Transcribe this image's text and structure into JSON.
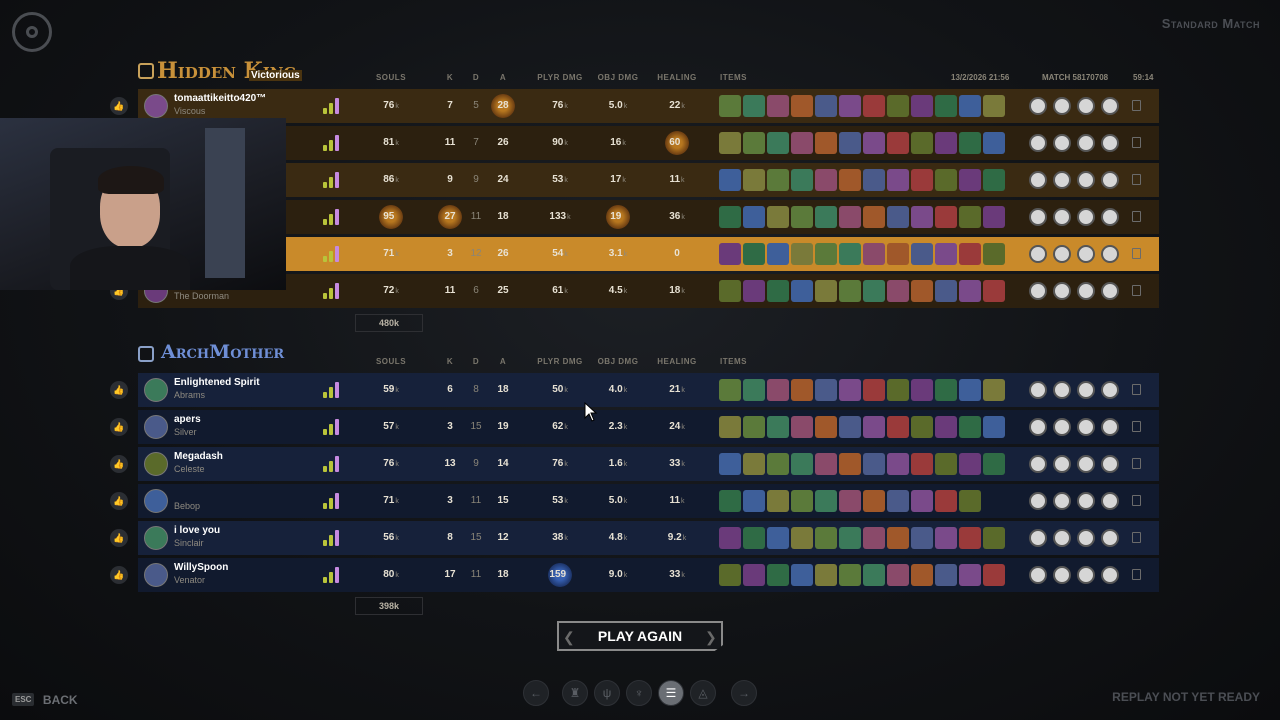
{
  "header": {
    "mode": "Standard Match",
    "date": "13/2/2026 21:56",
    "match_id": "Match 58170708",
    "duration": "59:14"
  },
  "columns": {
    "souls": "SOULS",
    "k": "K",
    "d": "D",
    "a": "A",
    "plyr_dmg": "PLYR DMG",
    "obj_dmg": "OBJ DMG",
    "healing": "HEALING",
    "items": "ITEMS"
  },
  "team1": {
    "name": "Hidden King",
    "result": "Victorious",
    "total_souls": "480k",
    "players": [
      {
        "name": "tomaattikeitto420™",
        "hero": "Viscous",
        "souls": "76",
        "k": "7",
        "d": "5",
        "a": "28",
        "plyr": "76",
        "obj": "5.0",
        "heal": "22"
      },
      {
        "name": "",
        "hero": "",
        "souls": "81",
        "k": "11",
        "d": "7",
        "a": "26",
        "plyr": "90",
        "obj": "16",
        "heal": "60"
      },
      {
        "name": "",
        "hero": "",
        "souls": "86",
        "k": "9",
        "d": "9",
        "a": "24",
        "plyr": "53",
        "obj": "17",
        "heal": "11"
      },
      {
        "name": "",
        "hero": "",
        "souls": "95",
        "k": "27",
        "d": "11",
        "a": "18",
        "plyr": "133",
        "obj": "19",
        "heal": "36"
      },
      {
        "name": "",
        "hero": "",
        "souls": "71",
        "k": "3",
        "d": "12",
        "a": "26",
        "plyr": "54",
        "obj": "3.1",
        "heal": "0"
      },
      {
        "name": "",
        "hero": "The Doorman",
        "souls": "72",
        "k": "11",
        "d": "6",
        "a": "25",
        "plyr": "61",
        "obj": "4.5",
        "heal": "18"
      }
    ]
  },
  "team2": {
    "name": "ArchMother",
    "total_souls": "398k",
    "players": [
      {
        "name": "Enlightened Spirit",
        "hero": "Abrams",
        "souls": "59",
        "k": "6",
        "d": "8",
        "a": "18",
        "plyr": "50",
        "obj": "4.0",
        "heal": "21"
      },
      {
        "name": "apers",
        "hero": "Silver",
        "souls": "57",
        "k": "3",
        "d": "15",
        "a": "19",
        "plyr": "62",
        "obj": "2.3",
        "heal": "24"
      },
      {
        "name": "Megadash",
        "hero": "Celeste",
        "souls": "76",
        "k": "13",
        "d": "9",
        "a": "14",
        "plyr": "76",
        "obj": "1.6",
        "heal": "33"
      },
      {
        "name": "",
        "hero": "Bebop",
        "souls": "71",
        "k": "3",
        "d": "11",
        "a": "15",
        "plyr": "53",
        "obj": "5.0",
        "heal": "11"
      },
      {
        "name": "i love you",
        "hero": "Sinclair",
        "souls": "56",
        "k": "8",
        "d": "15",
        "a": "12",
        "plyr": "38",
        "obj": "4.8",
        "heal": "9.2"
      },
      {
        "name": "WillySpoon",
        "hero": "Venator",
        "souls": "80",
        "k": "17",
        "d": "11",
        "a": "18",
        "plyr": "159",
        "obj": "9.0",
        "heal": "33"
      }
    ]
  },
  "unit_suffix": "k",
  "footer": {
    "esc_key": "ESC",
    "back_label": "BACK",
    "play_again_label": "PLAY AGAIN",
    "replay_status": "REPLAY NOT YET READY"
  },
  "colors": {
    "team1_row": "#3a2a12",
    "team1_highlight": "#c98a2a",
    "team2_row": "#16213a",
    "team1_title": "#c8913a",
    "team2_title": "#6f8fd6"
  }
}
